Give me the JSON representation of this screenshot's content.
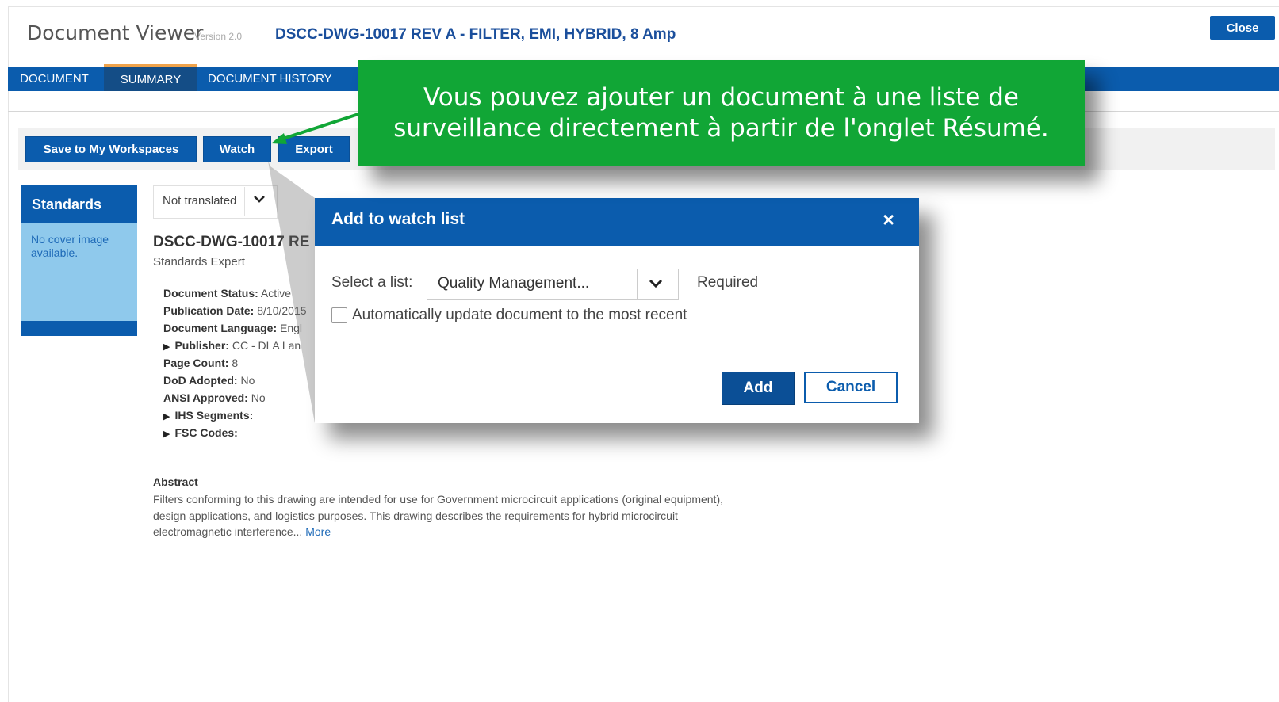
{
  "header": {
    "app_title": "Document Viewer",
    "version": "Version 2.0",
    "doc_title": "DSCC-DWG-10017 REV A - FILTER, EMI, HYBRID, 8 Amp",
    "close_label": "Close"
  },
  "tabs": [
    {
      "label": "DOCUMENT",
      "active": false
    },
    {
      "label": "SUMMARY",
      "active": true
    },
    {
      "label": "DOCUMENT HISTORY",
      "active": false
    }
  ],
  "toolbar": {
    "save_label": "Save to My Workspaces",
    "watch_label": "Watch",
    "export_label": "Export"
  },
  "standards": {
    "title": "Standards",
    "no_cover": "No cover image available."
  },
  "language": {
    "selected": "Not translated"
  },
  "document": {
    "heading": "DSCC-DWG-10017 RE",
    "subtitle": "Standards Expert",
    "meta": [
      {
        "label": "Document Status:",
        "value": "Active"
      },
      {
        "label": "Publication Date:",
        "value": "8/10/2015"
      },
      {
        "label": "Document Language:",
        "value": "Engl"
      },
      {
        "label": "Publisher:",
        "value": "CC - DLA Lan"
      },
      {
        "label": "Page Count:",
        "value": "8"
      },
      {
        "label": "DoD Adopted:",
        "value": "No"
      },
      {
        "label": "ANSI Approved:",
        "value": "No"
      },
      {
        "label": "IHS Segments:",
        "value": ""
      },
      {
        "label": "FSC Codes:",
        "value": ""
      }
    ],
    "abstract_heading": "Abstract",
    "abstract_text": "Filters conforming to this drawing are intended for use for Government microcircuit applications (original equipment), design applications, and logistics purposes. This drawing describes the requirements for hybrid microcircuit electromagnetic interference...",
    "more_label": "More"
  },
  "callout": {
    "text": "Vous pouvez ajouter un document à une liste de surveillance directement à partir de l'onglet Résumé."
  },
  "dialog": {
    "title": "Add to watch list",
    "close_icon": "×",
    "select_label": "Select a list:",
    "select_value": "Quality Management...",
    "required_label": "Required",
    "checkbox_label": "Automatically update document to the most recent",
    "checkbox_checked": false,
    "add_label": "Add",
    "cancel_label": "Cancel"
  },
  "colors": {
    "primary_blue": "#0b5cad",
    "active_tab_accent": "#f0a34b",
    "callout_green": "#11a636",
    "standards_panel": "#8fc9ec"
  }
}
